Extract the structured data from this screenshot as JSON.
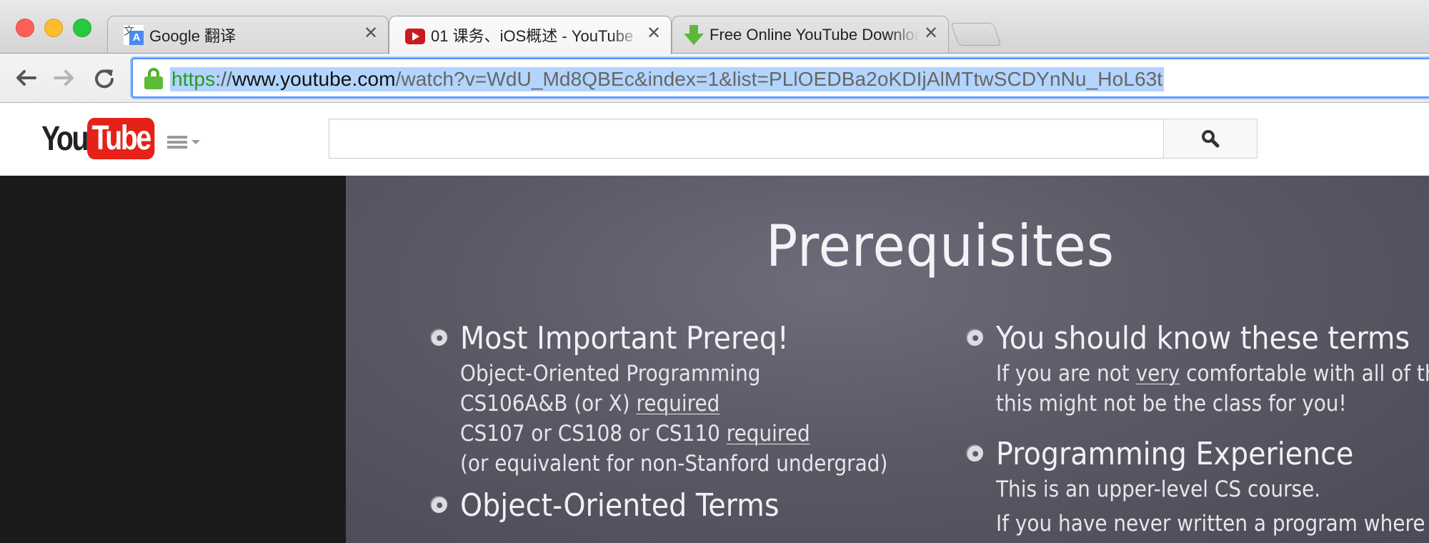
{
  "browser": {
    "tabs": [
      {
        "title": "Google 翻译",
        "icon": "google-translate-icon",
        "active": false
      },
      {
        "title": "01 课务、iOS概述 - YouTube",
        "icon": "youtube-icon",
        "active": true
      },
      {
        "title": "Free Online YouTube Downloader",
        "icon": "download-arrow-icon",
        "active": false
      }
    ],
    "close_glyph": "✕",
    "url": {
      "scheme": "https",
      "separator": "://",
      "host": "www.youtube.com",
      "path": "/watch?v=WdU_Md8QBEc&index=1&list=PLlOEDBa2oKDIjAlMTtwSCDYnNu_HoL63t"
    }
  },
  "youtube": {
    "logo_you": "You",
    "logo_tube": "Tube",
    "search": {
      "value": "",
      "placeholder": ""
    }
  },
  "slide": {
    "title": "Prerequisites",
    "left_bullets": [
      {
        "heading": "Most Important Prereq!",
        "lines": [
          {
            "text": "Object-Oriented Programming"
          },
          {
            "pre": "CS106A&B (or X) ",
            "u": "required"
          },
          {
            "pre": "CS107 or CS108 or CS110 ",
            "u": "required"
          },
          {
            "text": "(or equivalent for non-Stanford undergrad)"
          }
        ]
      },
      {
        "heading": "Object-Oriented Terms",
        "lines": []
      }
    ],
    "right_bullets": [
      {
        "heading": "You should know these terms",
        "lines": [
          {
            "pre": "If you are not ",
            "u": "very",
            "post": " comfortable with all of these,"
          },
          {
            "text": "this might not be the class for you!"
          }
        ]
      },
      {
        "heading": "Programming Experience",
        "lines": [
          {
            "text": "This is an upper-level CS course."
          },
          {
            "text": "If you have never written a program where"
          }
        ]
      }
    ]
  },
  "colors": {
    "youtube_red": "#e62117",
    "omnibox_focus": "#4d90fe",
    "url_highlight": "#b3d4fd",
    "https_green": "#279a1f",
    "slide_bg": "#5b5966"
  }
}
